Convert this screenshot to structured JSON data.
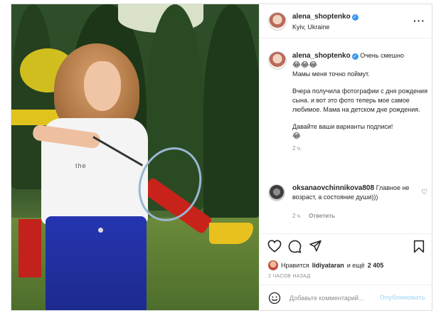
{
  "post": {
    "username": "alena_shoptenko",
    "location": "Kyiv, Ukraine",
    "verified_mark": "✓",
    "more_icon": "more-horizontal-icon",
    "caption": {
      "first_line": "Очень смешно",
      "emojis": "😂😂😂",
      "p1": "Мамы меня точно поймут.",
      "p2": "Вчера получила фотографии с дня рождения сына. и вот это фото теперь мое самое любимое. Мама на детском дне рождения.",
      "p3": "Давайте ваши варианты подписи!",
      "p3_emoji": "😂",
      "time": "2 ч."
    },
    "comment": {
      "username": "oksanaovchinnikova808",
      "text": "Главное не возраст, а состояние души)))",
      "time": "2 ч.",
      "reply_label": "Ответить"
    },
    "actions": {
      "icons": [
        "heart-icon",
        "comment-icon",
        "share-icon",
        "bookmark-icon"
      ]
    },
    "likes": {
      "prefix": "Нравится",
      "user": "lidiyataran",
      "middle": "и ещё",
      "count": "2 405"
    },
    "timeago": "2 ЧАСОВ НАЗАД",
    "comment_input": {
      "placeholder": "Добавьте комментарий...",
      "publish_label": "Опубликовать"
    },
    "photo_shirt_text": "the"
  }
}
